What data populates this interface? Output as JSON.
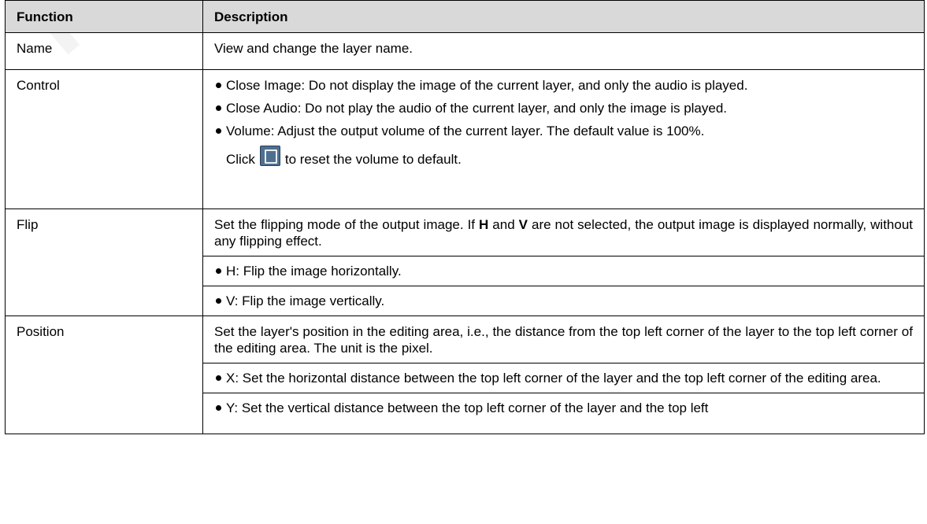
{
  "watermark": "NOVASTAR",
  "table": {
    "headers": {
      "function": "Function",
      "description": "Description"
    },
    "rows": {
      "name": {
        "function": "Name",
        "text": "View and change the layer name."
      },
      "control": {
        "function": "Control",
        "bullet1": "Close Image: Do not display the image of the current layer, and only the audio is played.",
        "bullet2": "Close Audio: Do not play the audio of the current layer, and only the image is played.",
        "bullet3": "Volume: Adjust the output volume of the current layer. The default value is 100%.",
        "click_prefix": "Click",
        "click_suffix": "to reset the volume to default.",
        "reset_icon": "reset-icon"
      },
      "flip": {
        "function": "Flip",
        "intro_1": "Set the flipping mode of the output image. If ",
        "intro_h": "H",
        "intro_2": " and ",
        "intro_v": "V",
        "intro_3": " are not selected, the output image is displayed normally, without any flipping effect.",
        "bullet_h": "H: Flip the image horizontally.",
        "bullet_v": "V: Flip the image vertically."
      },
      "position": {
        "function": "Position",
        "intro": "Set the layer's position in the editing area, i.e., the distance from the top left corner of the layer to the top left corner of the editing area. The unit is the pixel.",
        "bullet_x": "X: Set the horizontal distance between the top left corner of the layer and the top left corner of the editing area.",
        "bullet_y": "Y: Set the vertical distance between the top left corner of the layer and the top left"
      }
    }
  }
}
